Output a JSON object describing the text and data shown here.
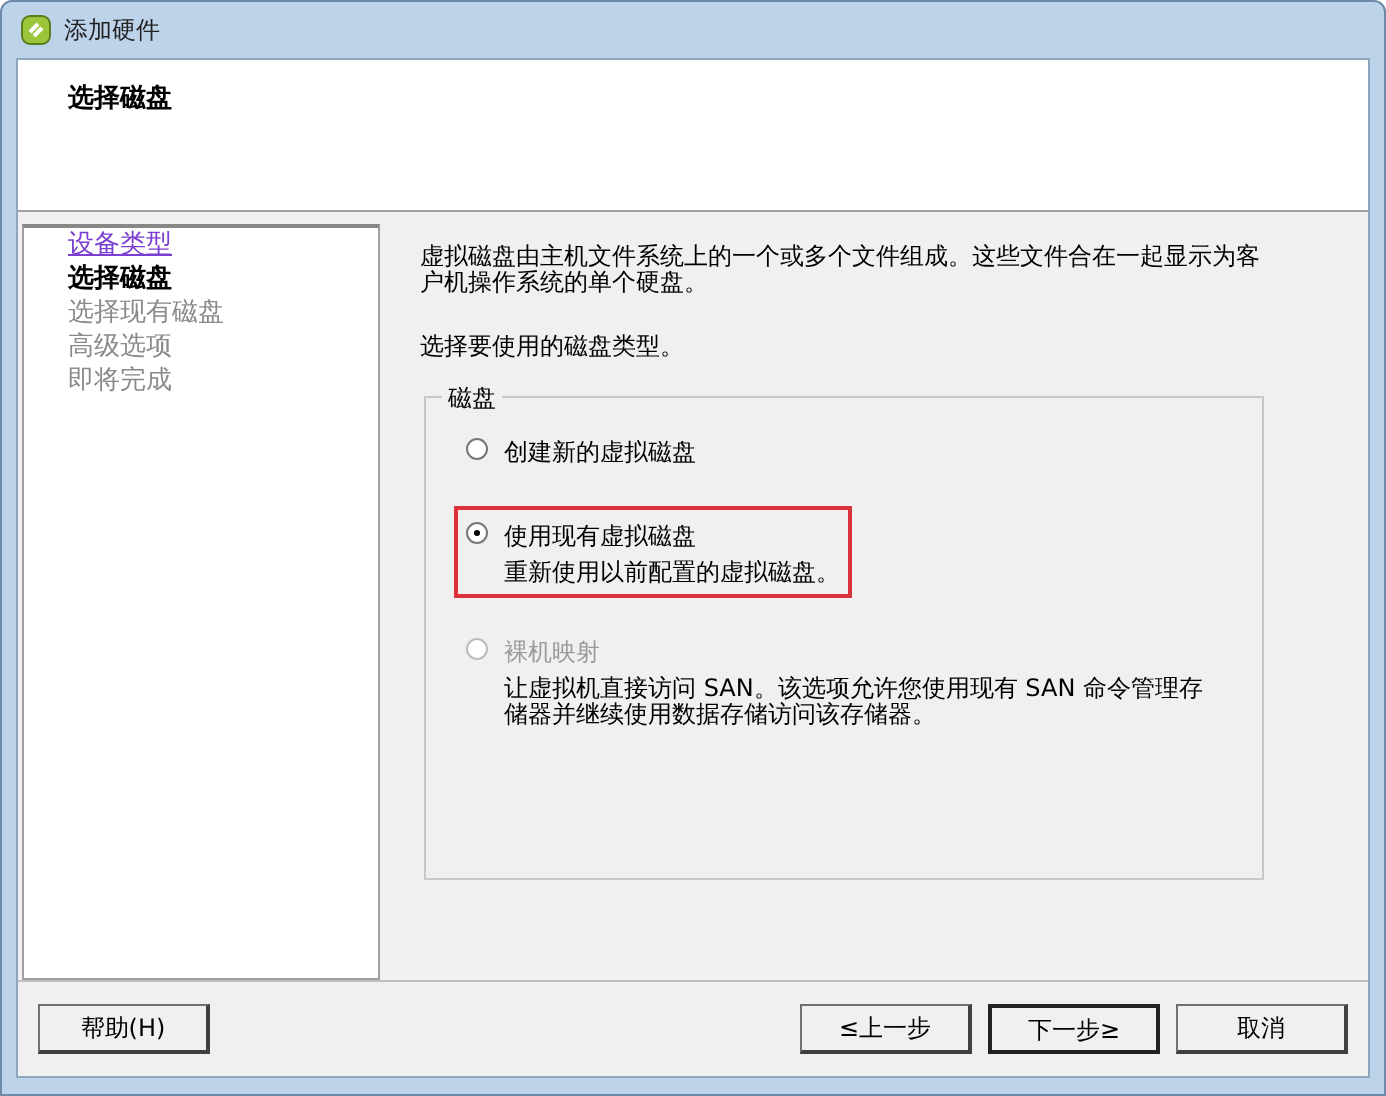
{
  "window": {
    "title": "添加硬件"
  },
  "header": {
    "title": "选择磁盘"
  },
  "steps": [
    {
      "label": "设备类型",
      "kind": "link"
    },
    {
      "label": "选择磁盘",
      "kind": "current"
    },
    {
      "label": "选择现有磁盘",
      "kind": "pending"
    },
    {
      "label": "高级选项",
      "kind": "pending"
    },
    {
      "label": "即将完成",
      "kind": "pending"
    }
  ],
  "intro": "虚拟磁盘由主机文件系统上的一个或多个文件组成。这些文件合在一起显示为客户机操作系统的单个硬盘。",
  "prompt": "选择要使用的磁盘类型。",
  "group": {
    "legend": "磁盘",
    "options": [
      {
        "label": "创建新的虚拟磁盘",
        "selected": false,
        "disabled": false,
        "highlighted": false
      },
      {
        "label": "使用现有虚拟磁盘",
        "description": "重新使用以前配置的虚拟磁盘。",
        "selected": true,
        "disabled": false,
        "highlighted": true
      },
      {
        "label": "裸机映射",
        "description": "让虚拟机直接访问 SAN。该选项允许您使用现有 SAN 命令管理存储器并继续使用数据存储访问该存储器。",
        "selected": false,
        "disabled": true,
        "highlighted": false
      }
    ]
  },
  "left_buttons": [
    {
      "label": "帮助(H)",
      "default": false
    }
  ],
  "right_buttons": [
    {
      "label": "≤上一步",
      "default": false
    },
    {
      "label": "下一步≥",
      "default": true
    },
    {
      "label": "取消",
      "default": false
    }
  ]
}
